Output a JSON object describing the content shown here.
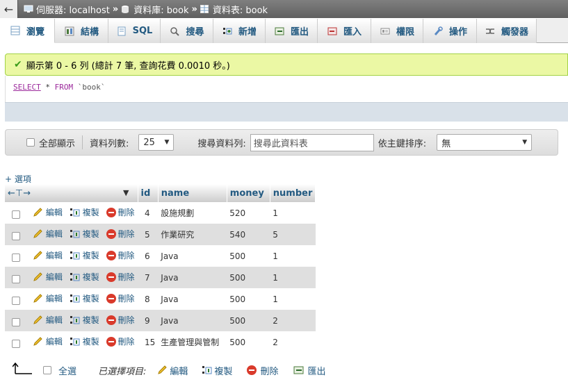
{
  "breadcrumb": {
    "server_label": "伺服器: localhost",
    "database_label": "資料庫: book",
    "table_label": "資料表: book",
    "separator": "»"
  },
  "tabs": [
    {
      "label": "瀏覽",
      "icon": "browse-icon",
      "active": true
    },
    {
      "label": "結構",
      "icon": "structure-icon"
    },
    {
      "label": "SQL",
      "icon": "sql-icon"
    },
    {
      "label": "搜尋",
      "icon": "search-icon"
    },
    {
      "label": "新增",
      "icon": "insert-icon"
    },
    {
      "label": "匯出",
      "icon": "export-icon"
    },
    {
      "label": "匯入",
      "icon": "import-icon"
    },
    {
      "label": "權限",
      "icon": "privileges-icon"
    },
    {
      "label": "操作",
      "icon": "operations-icon"
    },
    {
      "label": "觸發器",
      "icon": "triggers-icon"
    }
  ],
  "message": {
    "text": "顯示第 0 - 6 列 (總計 7 筆, 查詢花費 0.0010 秒。)"
  },
  "sql": {
    "select": "SELECT",
    "star": "*",
    "from": "FROM",
    "table": "`book`"
  },
  "nav": {
    "show_all_label": "全部顯示",
    "rows_label": "資料列數:",
    "rows_value": "25",
    "filter_label": "搜尋資料列:",
    "filter_placeholder": "搜尋此資料表",
    "sort_label": "依主鍵排序:",
    "sort_value": "無"
  },
  "options_link": "+ 選項",
  "table": {
    "columns": [
      "id",
      "name",
      "money",
      "number"
    ],
    "actions": {
      "edit": "編輯",
      "copy": "複製",
      "delete": "刪除"
    },
    "rows": [
      {
        "id": "4",
        "name": "設施規劃",
        "money": "520",
        "number": "1"
      },
      {
        "id": "5",
        "name": "作業研究",
        "money": "540",
        "number": "5"
      },
      {
        "id": "6",
        "name": "Java",
        "money": "500",
        "number": "1"
      },
      {
        "id": "7",
        "name": "Java",
        "money": "500",
        "number": "1"
      },
      {
        "id": "8",
        "name": "Java",
        "money": "500",
        "number": "1"
      },
      {
        "id": "9",
        "name": "Java",
        "money": "500",
        "number": "2"
      },
      {
        "id": "15",
        "name": "生產管理與管制",
        "money": "500",
        "number": "2"
      }
    ]
  },
  "bottom": {
    "check_all": "全選",
    "with_selected": "已選擇項目:",
    "edit": "編輯",
    "copy": "複製",
    "delete": "刪除",
    "export": "匯出"
  },
  "colors": {
    "link": "#235a81",
    "success_bg": "#ebf8a4",
    "success_border": "#a2d246",
    "delete_red": "#d93a2b"
  }
}
